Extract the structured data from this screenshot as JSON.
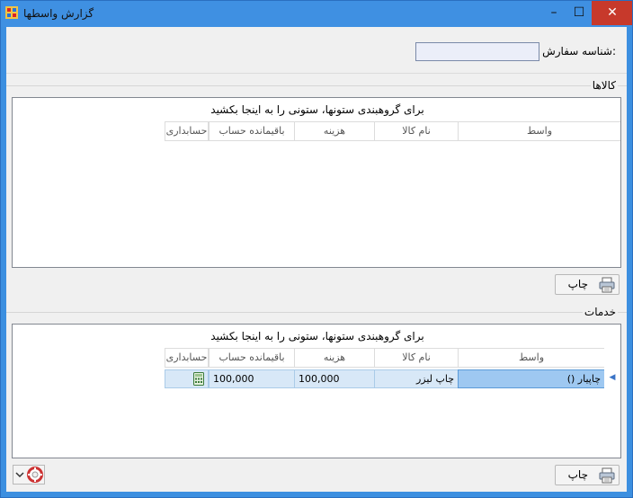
{
  "window": {
    "title": "گزارش واسطها",
    "minimize": "–",
    "maximize": "☐",
    "close": "✕"
  },
  "order": {
    "label": "شناسه سفارش:",
    "value": ""
  },
  "goods": {
    "title": "کالاها",
    "group_hint": "برای گروهبندی ستونها، ستونی را به اینجا بکشید",
    "columns": [
      "واسط",
      "نام کالا",
      "هزینه",
      "باقیمانده حساب",
      "حسابداری"
    ],
    "rows": [],
    "print_label": "چاپ"
  },
  "services": {
    "title": "خدمات",
    "group_hint": "برای گروهبندی ستونها، ستونی را به اینجا بکشید",
    "columns": [
      "واسط",
      "نام کالا",
      "هزینه",
      "باقیمانده حساب",
      "حسابداری"
    ],
    "rows": [
      {
        "intermediary": "چاپیار ()",
        "item_name": "چاپ لیزر",
        "cost": "100,000",
        "balance": "100,000",
        "accounting_icon": "calculator-icon"
      }
    ],
    "print_label": "چاپ"
  },
  "icons": {
    "print": "printer-icon",
    "help": "lifebuoy-icon",
    "dropdown": "chevron-down-icon"
  }
}
